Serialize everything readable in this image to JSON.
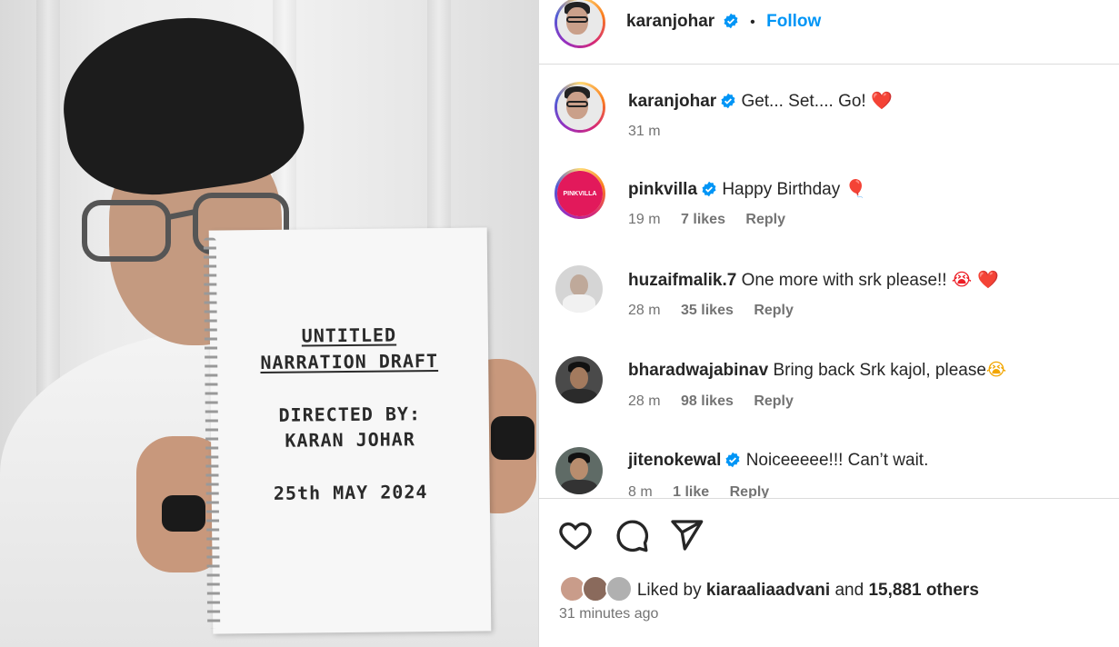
{
  "post_image": {
    "notebook": {
      "title_line1": "UNTITLED",
      "title_line2": "NARRATION DRAFT",
      "directed_by": "DIRECTED BY:",
      "director": "KARAN JOHAR",
      "date": "25th MAY 2024"
    }
  },
  "header": {
    "username": "karanjohar",
    "separator": "•",
    "follow_label": "Follow"
  },
  "comments": [
    {
      "username": "karanjohar",
      "verified": true,
      "text": "Get... Set.... Go!",
      "emoji": "❤️",
      "time": "31 m",
      "likes": "",
      "reply": ""
    },
    {
      "username": "pinkvilla",
      "verified": true,
      "text": "Happy Birthday",
      "emoji": "🎈",
      "time": "19 m",
      "likes": "7 likes",
      "reply": "Reply",
      "avatar_text": "PINKVILLA"
    },
    {
      "username": "huzaifmalik.7",
      "verified": false,
      "text": "One more with srk please!!",
      "emoji": "😭 ❤️",
      "time": "28 m",
      "likes": "35 likes",
      "reply": "Reply"
    },
    {
      "username": "bharadwajabinav",
      "verified": false,
      "text": "Bring back Srk kajol, please",
      "emoji": "😭",
      "time": "28 m",
      "likes": "98 likes",
      "reply": "Reply"
    },
    {
      "username": "jitenokewal",
      "verified": true,
      "text": "Noiceeeee!!! Can’t wait.",
      "emoji": "",
      "time": "8 m",
      "likes": "1 like",
      "reply": "Reply"
    }
  ],
  "footer": {
    "liked_prefix": "Liked by",
    "liked_user": "kiaraaliaadvani",
    "liked_and": "and",
    "liked_others": "15,881 others",
    "time_ago": "31 minutes ago"
  },
  "colors": {
    "follow": "#0095f6",
    "verified": "#0095f6",
    "heart": "#ed1c24",
    "pinkvilla": "#e2195b"
  },
  "icons": [
    "heart-icon",
    "comment-icon",
    "share-icon",
    "verified-badge-icon"
  ]
}
